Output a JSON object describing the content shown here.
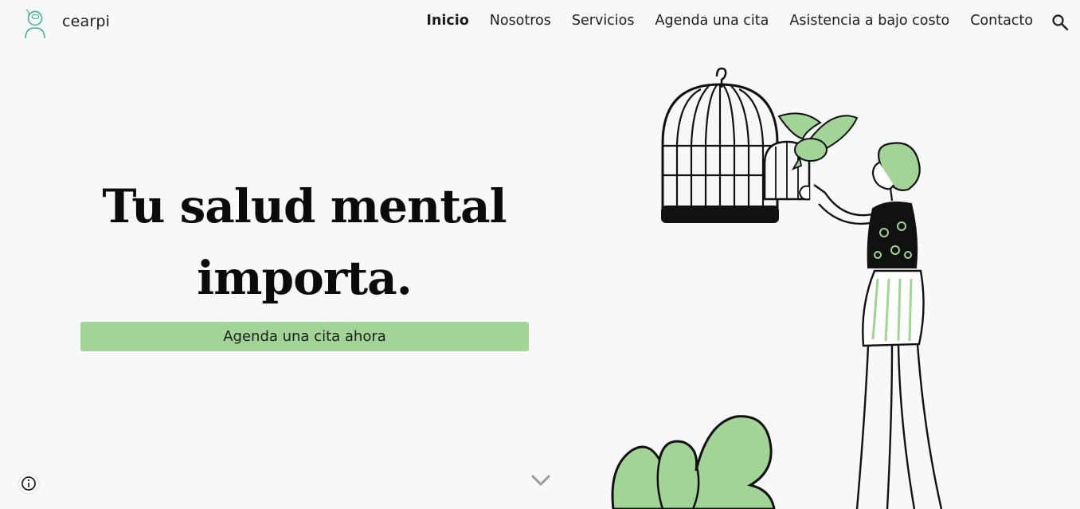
{
  "header": {
    "brand": "cearpi",
    "nav": [
      {
        "label": "Inicio",
        "active": true
      },
      {
        "label": "Nosotros",
        "active": false
      },
      {
        "label": "Servicios",
        "active": false
      },
      {
        "label": "Agenda una cita",
        "active": false
      },
      {
        "label": "Asistencia a bajo costo",
        "active": false
      },
      {
        "label": "Contacto",
        "active": false
      }
    ],
    "icons": {
      "logo": "person-with-brain-logo",
      "search": "search-icon"
    }
  },
  "hero": {
    "title_line1": "Tu salud mental",
    "title_line2": "importa.",
    "cta_label": "Agenda una cita ahora"
  },
  "icons": {
    "scroll": "chevron-down-icon",
    "info": "info-icon",
    "illustration": "woman-releasing-bird-from-cage"
  },
  "colors": {
    "background": "#f7f9f8",
    "accent": "#a1d496",
    "text": "#1d1d1d"
  }
}
